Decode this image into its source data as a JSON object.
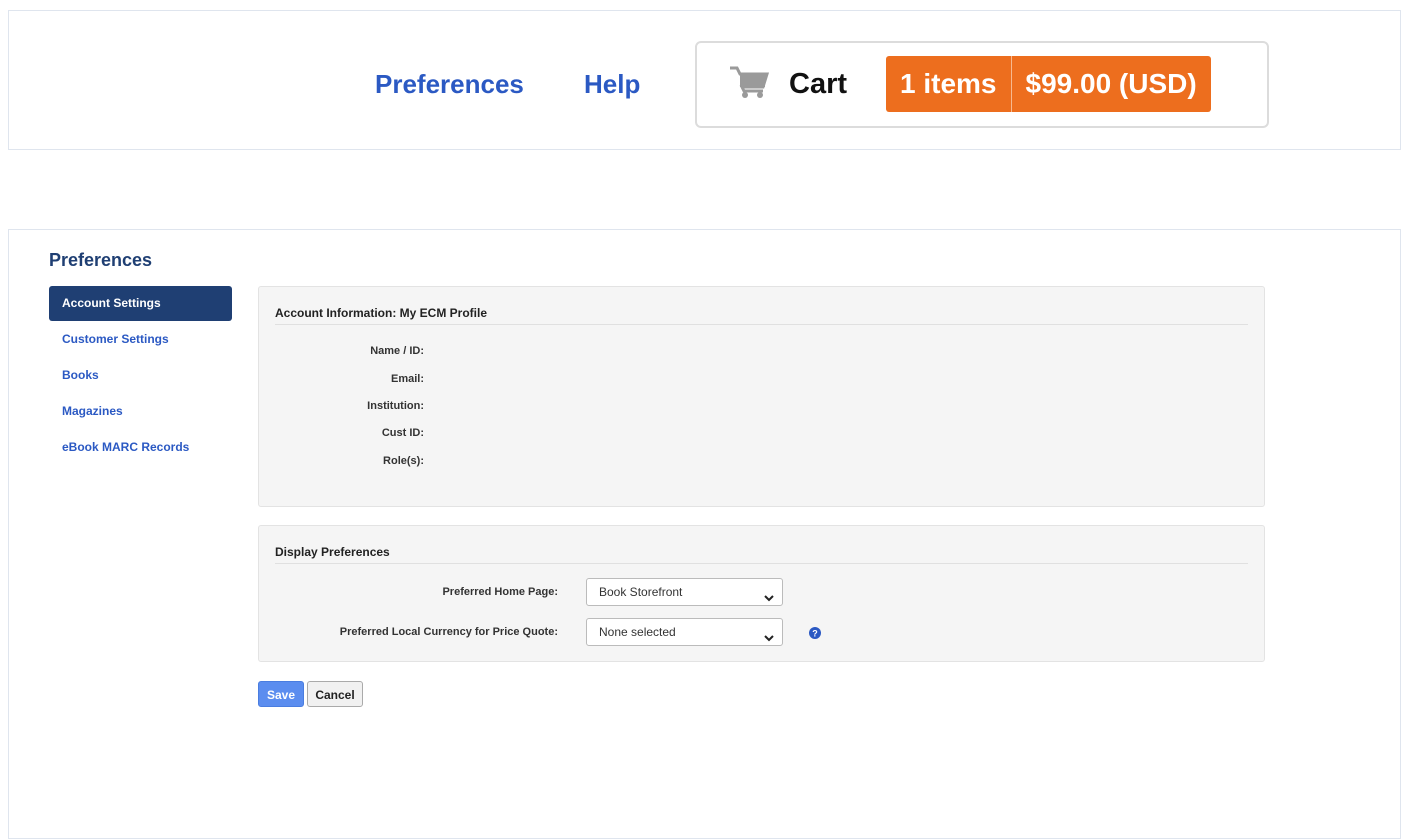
{
  "header": {
    "nav": {
      "preferences": "Preferences",
      "help": "Help"
    },
    "cart": {
      "label": "Cart",
      "count": "1 items",
      "total": "$99.00 (USD)",
      "icon": "cart-icon",
      "badge_color": "#ed6e1e"
    }
  },
  "page": {
    "title": "Preferences"
  },
  "sidebar": {
    "items": [
      {
        "label": "Account Settings",
        "active": true
      },
      {
        "label": "Customer Settings",
        "active": false
      },
      {
        "label": "Books",
        "active": false
      },
      {
        "label": "Magazines",
        "active": false
      },
      {
        "label": "eBook MARC Records",
        "active": false
      }
    ]
  },
  "account": {
    "heading": "Account Information: My ECM Profile",
    "fields": [
      {
        "label": "Name / ID:",
        "value": ""
      },
      {
        "label": "Email:",
        "value": ""
      },
      {
        "label": "Institution:",
        "value": ""
      },
      {
        "label": "Cust ID:",
        "value": ""
      },
      {
        "label": "Role(s):",
        "value": ""
      }
    ]
  },
  "display": {
    "heading": "Display Preferences",
    "home_page": {
      "label": "Preferred Home Page:",
      "selected": "Book Storefront"
    },
    "currency": {
      "label": "Preferred Local Currency for Price Quote:",
      "selected": "None selected",
      "help_icon": "question-circle-icon"
    }
  },
  "buttons": {
    "save": "Save",
    "cancel": "Cancel"
  },
  "colors": {
    "brand_dark": "#1f3f73",
    "link": "#2b59c3",
    "save_button": "#5b8def"
  }
}
